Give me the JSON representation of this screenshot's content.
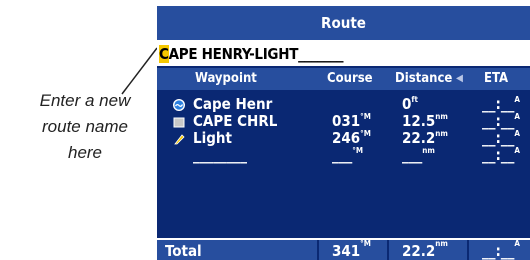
{
  "callout": {
    "line1": "Enter a new",
    "line2": "route name",
    "line3": "here"
  },
  "screen": {
    "title": "Route",
    "route_name_cursor": "C",
    "route_name_rest": "APE HENRY-LIGHT_______"
  },
  "table": {
    "headers": {
      "waypoint": "Waypoint",
      "course": "Course",
      "distance": "Distance",
      "arrow": "◀",
      "eta": "ETA"
    },
    "rows": [
      {
        "icon": "lighthouse-circle-icon",
        "name": "Cape Henr",
        "course": "",
        "course_unit": "",
        "distance": "0",
        "distance_unit": "ft",
        "eta": "__:__",
        "eta_unit": "A"
      },
      {
        "icon": "square-waypoint-icon",
        "name": "CAPE CHRL",
        "course": "031",
        "course_unit": "°M",
        "distance": "12.5",
        "distance_unit": "nm",
        "eta": "__:__",
        "eta_unit": "A"
      },
      {
        "icon": "marker-flag-icon",
        "name": "Light",
        "course": "246",
        "course_unit": "°M",
        "distance": "22.2",
        "distance_unit": "nm",
        "eta": "__:__",
        "eta_unit": "A"
      },
      {
        "icon": "",
        "name": "________",
        "course": "___",
        "course_unit": "°M",
        "distance": "___",
        "distance_unit": "nm",
        "eta": "__:__",
        "eta_unit": "A"
      }
    ]
  },
  "total": {
    "label": "Total",
    "course": "341",
    "course_unit": "°M",
    "distance": "22.2",
    "distance_unit": "nm",
    "eta": "__:__",
    "eta_unit": "A"
  },
  "colors": {
    "screen_bg": "#0a2873",
    "bar_bg": "#274e9e",
    "cursor": "#f5c800"
  }
}
